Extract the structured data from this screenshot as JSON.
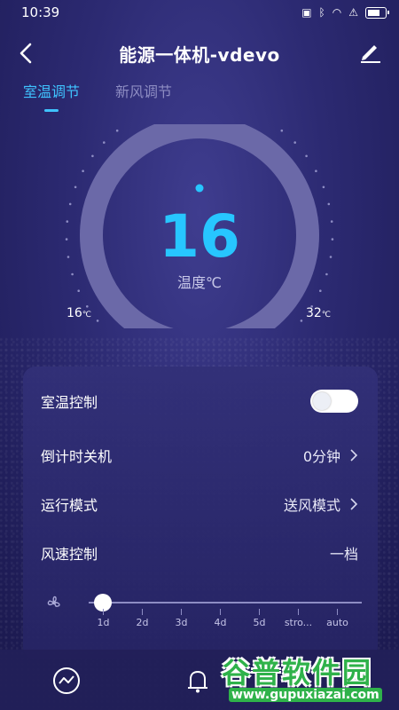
{
  "status_bar": {
    "time": "10:39"
  },
  "header": {
    "title": "能源一体机-vdevo"
  },
  "tabs": [
    {
      "label": "室温调节",
      "active": true
    },
    {
      "label": "新风调节",
      "active": false
    }
  ],
  "dial": {
    "value": "16",
    "unit_label": "温度℃",
    "min_label": "16",
    "max_label": "32",
    "unit_small": "℃"
  },
  "card": {
    "rows": [
      {
        "label": "室温控制",
        "type": "toggle",
        "on": false
      },
      {
        "label": "倒计时关机",
        "value": "0分钟"
      },
      {
        "label": "运行模式",
        "value": "送风模式"
      },
      {
        "label": "风速控制",
        "value": "一档"
      }
    ],
    "speed_slider": {
      "labels": [
        "1d",
        "2d",
        "3d",
        "4d",
        "5d",
        "stro...",
        "auto"
      ],
      "selected_index": 0
    }
  },
  "watermark": {
    "main": "谷普软件园",
    "sub": "www.gupuxiazai.com"
  },
  "colors": {
    "accent": "#27c6ff",
    "tab_active": "#3fc3ff",
    "ring": "#6b69a8",
    "watermark_green": "#2fb24a"
  }
}
